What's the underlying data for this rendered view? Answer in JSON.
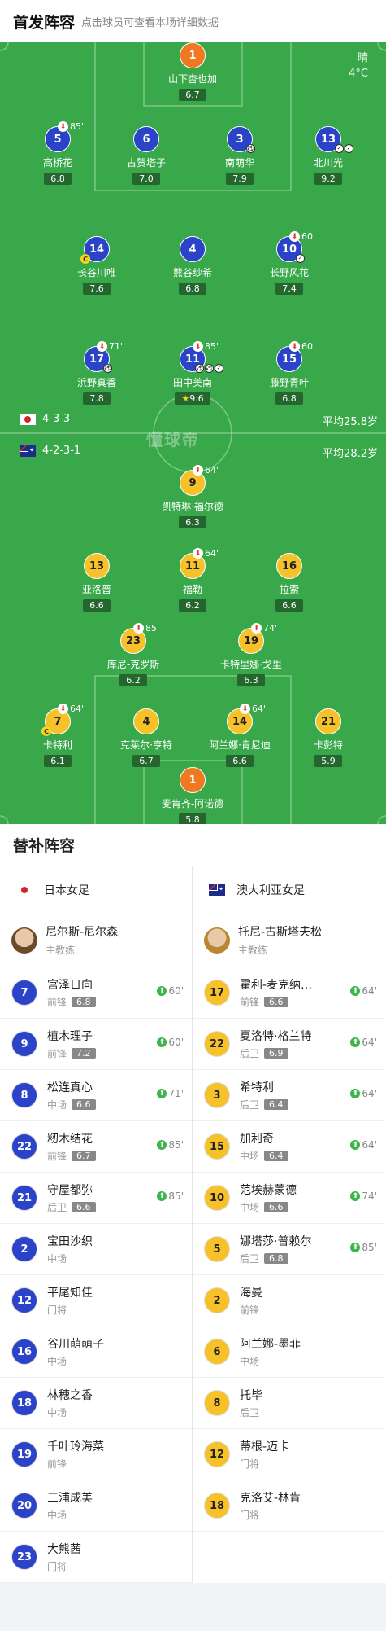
{
  "header": {
    "title": "首发阵容",
    "subtitle": "点击球员可查看本场详细数据"
  },
  "weather": {
    "condition": "晴",
    "temperature": "4°C"
  },
  "watermark": "懂球帝",
  "home": {
    "formation": "4-3-3",
    "avg_age": "平均25.8岁",
    "players": [
      {
        "num": "1",
        "name": "山下杏也加",
        "rating": "6.7",
        "gk": true
      },
      {
        "num": "5",
        "name": "高桥花",
        "rating": "6.8",
        "sub": "85'"
      },
      {
        "num": "6",
        "name": "古贺塔子",
        "rating": "7.0"
      },
      {
        "num": "3",
        "name": "南萌华",
        "rating": "7.9"
      },
      {
        "num": "13",
        "name": "北川光",
        "rating": "9.2"
      },
      {
        "num": "14",
        "name": "长谷川唯",
        "rating": "7.6"
      },
      {
        "num": "4",
        "name": "熊谷纱希",
        "rating": "6.8"
      },
      {
        "num": "10",
        "name": "长野风花",
        "rating": "7.4",
        "sub": "60'"
      },
      {
        "num": "17",
        "name": "浜野真香",
        "rating": "7.8",
        "sub": "71'"
      },
      {
        "num": "11",
        "name": "田中美南",
        "rating": "9.6",
        "sub": "85'"
      },
      {
        "num": "15",
        "name": "藤野青叶",
        "rating": "6.8",
        "sub": "60'"
      }
    ]
  },
  "away": {
    "formation": "4-2-3-1",
    "avg_age": "平均28.2岁",
    "players": [
      {
        "num": "9",
        "name": "凯特琳·福尔德",
        "rating": "6.3",
        "sub": "64'"
      },
      {
        "num": "13",
        "name": "亚洛普",
        "rating": "6.6"
      },
      {
        "num": "11",
        "name": "福勒",
        "rating": "6.2",
        "sub": "64'"
      },
      {
        "num": "16",
        "name": "拉索",
        "rating": "6.6"
      },
      {
        "num": "23",
        "name": "库尼-克罗斯",
        "rating": "6.2",
        "sub": "85'"
      },
      {
        "num": "19",
        "name": "卡特里娜·戈里",
        "rating": "6.3",
        "sub": "74'"
      },
      {
        "num": "7",
        "name": "卡特利",
        "rating": "6.1",
        "sub": "64'"
      },
      {
        "num": "4",
        "name": "克莱尔·亨特",
        "rating": "6.7"
      },
      {
        "num": "14",
        "name": "阿兰娜·肯尼迪",
        "rating": "6.6",
        "sub": "64'"
      },
      {
        "num": "21",
        "name": "卡彭特",
        "rating": "5.9"
      },
      {
        "num": "1",
        "name": "麦肯齐-阿诺德",
        "rating": "5.8",
        "gk": true
      }
    ]
  },
  "subs": {
    "title": "替补阵容",
    "home_team": "日本女足",
    "away_team": "澳大利亚女足",
    "home_coach": {
      "name": "尼尔斯-尼尔森",
      "role": "主教练"
    },
    "away_coach": {
      "name": "托尼-古斯塔夫松",
      "role": "主教练"
    },
    "home": [
      {
        "num": "7",
        "name": "宫泽日向",
        "pos": "前锋",
        "rating": "6.8",
        "min": "60'"
      },
      {
        "num": "9",
        "name": "植木理子",
        "pos": "前锋",
        "rating": "7.2",
        "min": "60'"
      },
      {
        "num": "8",
        "name": "松连真心",
        "pos": "中场",
        "rating": "6.6",
        "min": "71'"
      },
      {
        "num": "22",
        "name": "籾木结花",
        "pos": "前锋",
        "rating": "6.7",
        "min": "85'"
      },
      {
        "num": "21",
        "name": "守屋都弥",
        "pos": "后卫",
        "rating": "6.6",
        "min": "85'"
      },
      {
        "num": "2",
        "name": "宝田沙织",
        "pos": "中场"
      },
      {
        "num": "12",
        "name": "平尾知佳",
        "pos": "门将"
      },
      {
        "num": "16",
        "name": "谷川萌萌子",
        "pos": "中场"
      },
      {
        "num": "18",
        "name": "林穗之香",
        "pos": "中场"
      },
      {
        "num": "19",
        "name": "千叶玲海菜",
        "pos": "前锋"
      },
      {
        "num": "20",
        "name": "三浦成美",
        "pos": "中场"
      },
      {
        "num": "23",
        "name": "大熊茜",
        "pos": "门将"
      }
    ],
    "away": [
      {
        "num": "17",
        "name": "霍利-麦克纳…",
        "pos": "前锋",
        "rating": "6.6",
        "min": "64'"
      },
      {
        "num": "22",
        "name": "夏洛特·格兰特",
        "pos": "后卫",
        "rating": "6.9",
        "min": "64'"
      },
      {
        "num": "3",
        "name": "希特利",
        "pos": "后卫",
        "rating": "6.4",
        "min": "64'"
      },
      {
        "num": "15",
        "name": "加利奇",
        "pos": "中场",
        "rating": "6.4",
        "min": "64'"
      },
      {
        "num": "10",
        "name": "范埃赫蒙德",
        "pos": "中场",
        "rating": "6.6",
        "min": "74'"
      },
      {
        "num": "5",
        "name": "娜塔莎·普赖尔",
        "pos": "后卫",
        "rating": "6.8",
        "min": "85'"
      },
      {
        "num": "2",
        "name": "海曼",
        "pos": "前锋"
      },
      {
        "num": "6",
        "name": "阿兰娜-墨菲",
        "pos": "中场"
      },
      {
        "num": "8",
        "name": "托毕",
        "pos": "后卫"
      },
      {
        "num": "12",
        "name": "蒂根-迈卡",
        "pos": "门将"
      },
      {
        "num": "18",
        "name": "克洛艾-林肯",
        "pos": "门将"
      }
    ]
  }
}
